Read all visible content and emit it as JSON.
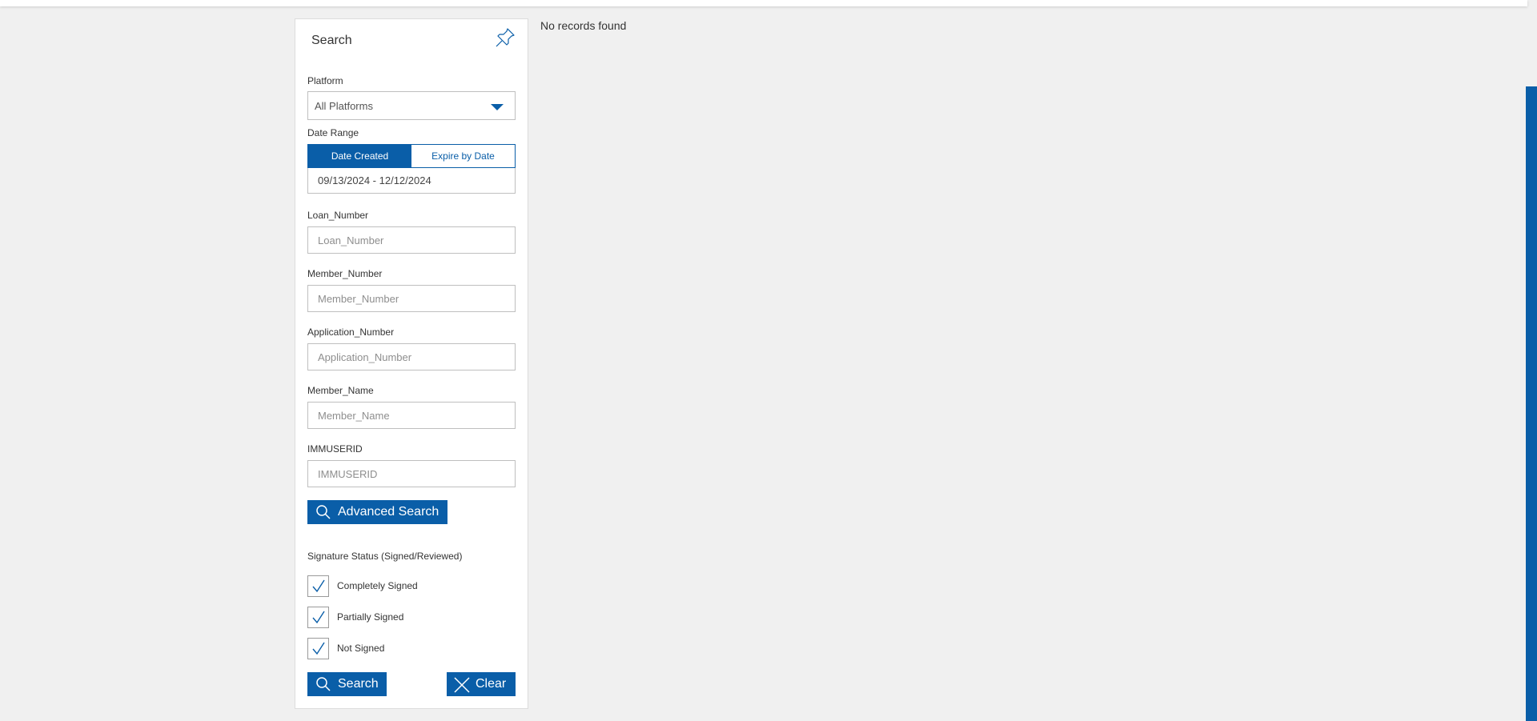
{
  "results": {
    "empty_message": "No records found"
  },
  "search_panel": {
    "title": "Search",
    "platform": {
      "label": "Platform",
      "value": "All Platforms"
    },
    "date_range": {
      "label": "Date Range",
      "tabs": [
        "Date Created",
        "Expire by Date"
      ],
      "active_tab": "Date Created",
      "value": "09/13/2024 - 12/12/2024"
    },
    "fields": [
      {
        "label": "Loan_Number",
        "placeholder": "Loan_Number",
        "value": ""
      },
      {
        "label": "Member_Number",
        "placeholder": "Member_Number",
        "value": ""
      },
      {
        "label": "Application_Number",
        "placeholder": "Application_Number",
        "value": ""
      },
      {
        "label": "Member_Name",
        "placeholder": "Member_Name",
        "value": ""
      },
      {
        "label": "IMMUSERID",
        "placeholder": "IMMUSERID",
        "value": ""
      }
    ],
    "advanced_search_label": "Advanced Search",
    "signature_status": {
      "label": "Signature Status (Signed/Reviewed)",
      "options": [
        {
          "label": "Completely Signed",
          "checked": true
        },
        {
          "label": "Partially Signed",
          "checked": true
        },
        {
          "label": "Not Signed",
          "checked": true
        }
      ]
    },
    "search_button_label": "Search",
    "clear_button_label": "Clear"
  },
  "colors": {
    "accent": "#0a5ea8",
    "background": "#f0f0f0",
    "panel": "#ffffff"
  },
  "icons": {
    "pin": "pin-icon",
    "search": "search-icon",
    "clear": "close-icon",
    "dropdown": "chevron-down-icon",
    "check": "checkmark-icon"
  }
}
